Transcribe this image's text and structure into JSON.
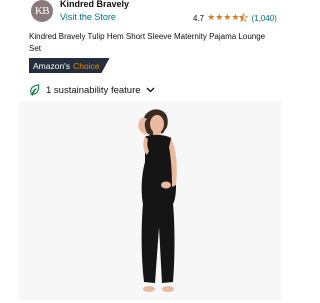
{
  "store": {
    "logo_text": "KB",
    "name": "Kindred Bravely",
    "visit_link": "Visit the Store",
    "rating": "4.7",
    "review_count": "(1,040)",
    "stars_filled": 4.5
  },
  "product": {
    "title": "Kindred Bravely Tulip Hem Short Sleeve Maternity Pajama Lounge Set"
  },
  "badge": {
    "prefix": "Amazon's",
    "label": "Choice"
  },
  "sustainability": {
    "label": "1 sustainability feature",
    "icon": "leaf-icon",
    "chevron": "chevron-down-icon"
  },
  "image": {
    "alt_subject": "product-photo"
  }
}
